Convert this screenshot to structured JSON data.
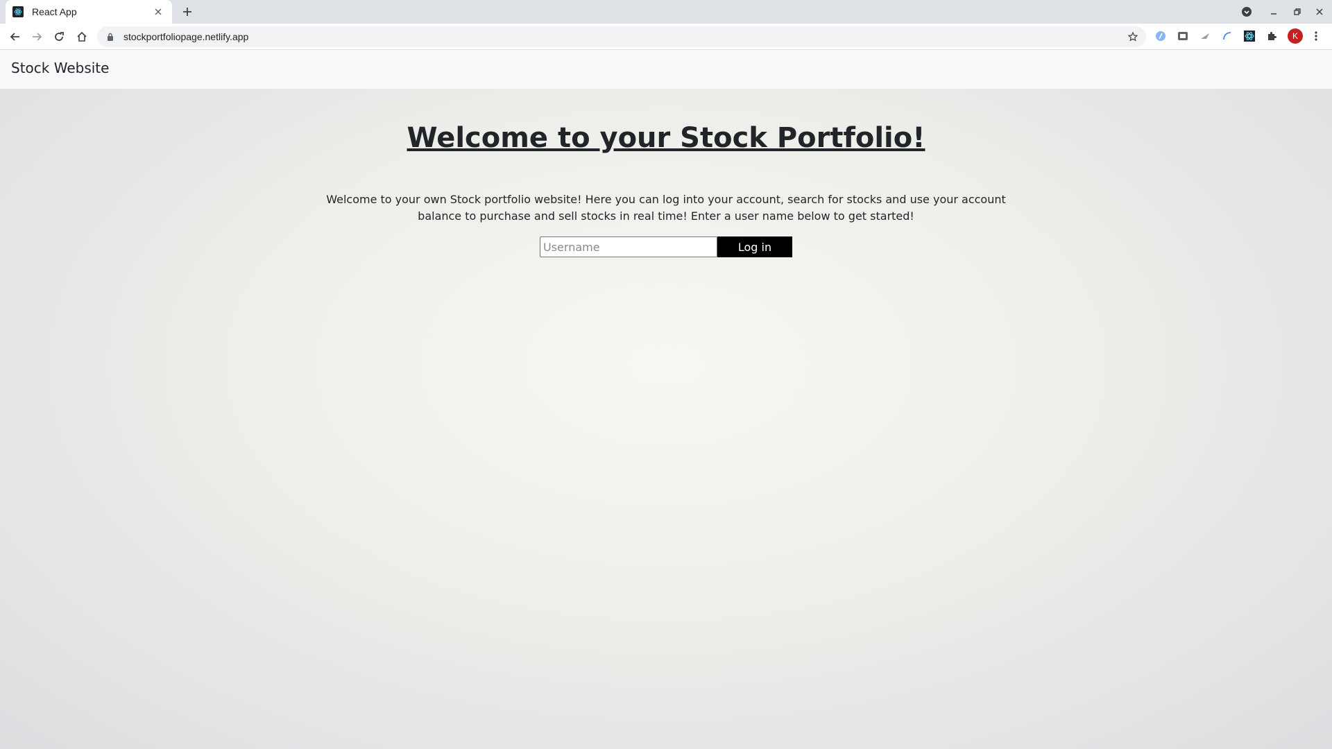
{
  "browser": {
    "tab_title": "React App",
    "url": "stockportfoliopage.netlify.app",
    "profile_initial": "K",
    "icons": [
      "back-icon",
      "forward-icon",
      "reload-icon",
      "home-icon",
      "lock-icon",
      "star-icon",
      "extensions-icon",
      "menu-icon"
    ]
  },
  "navbar": {
    "brand": "Stock Website"
  },
  "main": {
    "heading": "Welcome to your Stock Portfolio!",
    "intro": "Welcome to your own Stock portfolio website! Here you can log into your account, search for stocks and use your account balance to purchase and sell stocks in real time! Enter a user name below to get started!",
    "username_placeholder": "Username",
    "username_value": "",
    "login_label": "Log in"
  },
  "colors": {
    "button_bg": "#000000",
    "button_text": "#ffffff",
    "navbar_bg": "#f8f9fa",
    "avatar_bg": "#c5221f"
  }
}
